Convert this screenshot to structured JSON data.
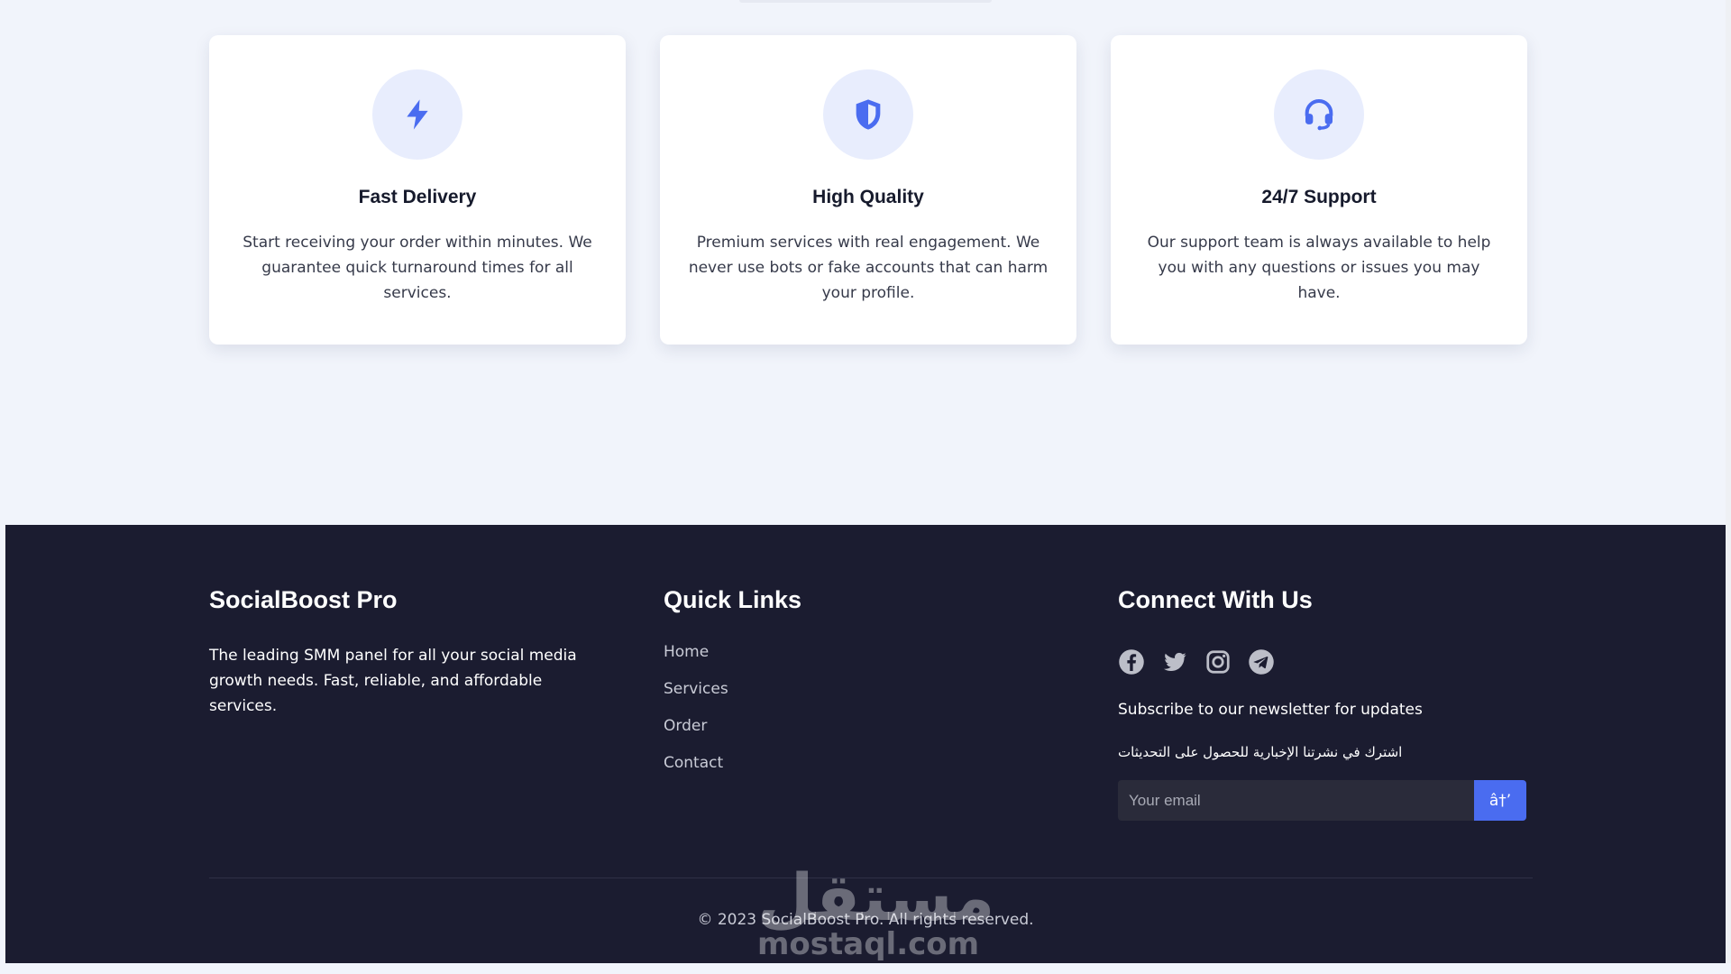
{
  "features": [
    {
      "icon": "lightning-icon",
      "title": "Fast Delivery",
      "description": "Start receiving your order within minutes. We guarantee quick turnaround times for all services."
    },
    {
      "icon": "shield-icon",
      "title": "High Quality",
      "description": "Premium services with real engagement. We never use bots or fake accounts that can harm your profile."
    },
    {
      "icon": "headset-icon",
      "title": "24/7 Support",
      "description": "Our support team is always available to help you with any questions or issues you may have."
    }
  ],
  "footer": {
    "brand_title": "SocialBoost Pro",
    "brand_description": "The leading SMM panel for all your social media growth needs. Fast, reliable, and affordable services.",
    "quick_links_title": "Quick Links",
    "quick_links": [
      "Home",
      "Services",
      "Order",
      "Contact"
    ],
    "connect_title": "Connect With Us",
    "social_icons": [
      "facebook-icon",
      "twitter-icon",
      "instagram-icon",
      "telegram-icon"
    ],
    "newsletter_text": "Subscribe to our newsletter for updates",
    "newsletter_text_ar": "اشترك في نشرتنا الإخبارية للحصول على التحديثات",
    "email_placeholder": "Your email",
    "subscribe_label": "â†’",
    "copyright": "© 2023 SocialBoost Pro. All rights reserved."
  },
  "watermark": {
    "arabic": "مستقل",
    "latin": "mostaql.com"
  },
  "colors": {
    "accent": "#4a6cf0",
    "icon_bg": "#e8edfd",
    "footer_bg": "#1b1c30",
    "page_bg": "#f1f4fb"
  }
}
